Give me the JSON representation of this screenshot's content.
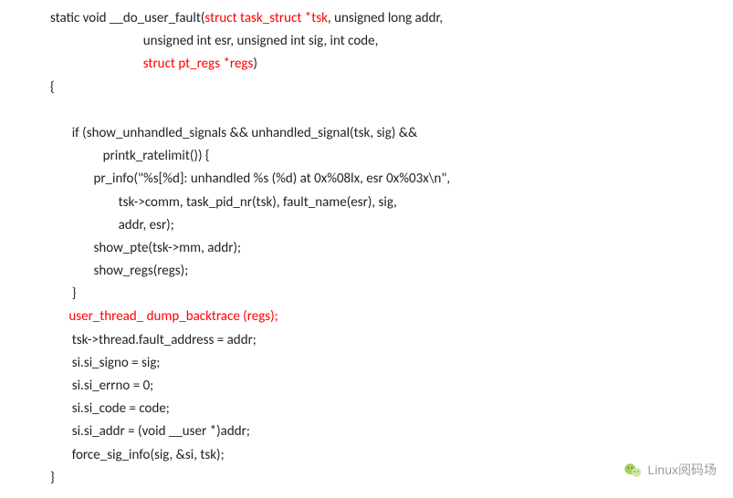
{
  "code": {
    "l1a": "static void __do_user_fault(",
    "l1b": "struct task_struct *tsk",
    "l1c": ", unsigned long addr,",
    "l2": "                              unsigned int esr, unsigned int sig, int code,",
    "l3a": "                              ",
    "l3b": "struct pt_regs *regs",
    "l3c": ")",
    "l4": "{",
    "l5": "",
    "l6": "       if (show_unhandled_signals && unhandled_signal(tsk, sig) &&",
    "l7": "                 printk_ratelimit()) {",
    "l8": "              pr_info(\"%s[%d]: unhandled %s (%d) at 0x%08lx, esr 0x%03x\\n\",",
    "l9": "                      tsk->comm, task_pid_nr(tsk), fault_name(esr), sig,",
    "l10": "                      addr, esr);",
    "l11": "              show_pte(tsk->mm, addr);",
    "l12": "              show_regs(regs);",
    "l13": "       }",
    "l14a": "      ",
    "l14b": "user_thread_ dump_backtrace (regs);",
    "l15": "       tsk->thread.fault_address = addr;",
    "l16": "       si.si_signo = sig;",
    "l17": "       si.si_errno = 0;",
    "l18": "       si.si_code = code;",
    "l19": "       si.si_addr = (void __user *)addr;",
    "l20": "       force_sig_info(sig, &si, tsk);",
    "l21": "}"
  },
  "watermark": {
    "text": "Linux阅码场"
  }
}
